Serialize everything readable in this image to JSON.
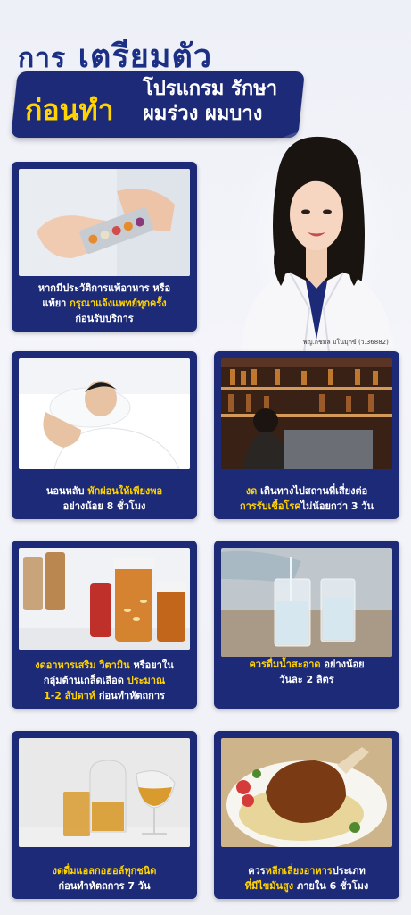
{
  "title": {
    "line1_prefix": "การ",
    "line1_main": "เตรียมตัว",
    "line2_left": "ก่อนทำ",
    "line2_right_top": "โปรแกรม รักษา",
    "line2_right_bottom": "ผมร่วง ผมบาง"
  },
  "doctor": {
    "caption": "พญ.กชมล มโนมุกข์ (ว.36882)"
  },
  "cards": [
    {
      "lines": [
        [
          {
            "t": "หากมีประวัติการแพ้อาหาร หรือ",
            "h": false
          }
        ],
        [
          {
            "t": "แพ้ยา ",
            "h": false
          },
          {
            "t": "กรุณาแจ้งแพทย์ทุกครั้ง",
            "h": true
          }
        ],
        [
          {
            "t": "ก่อนรับบริการ",
            "h": false
          }
        ]
      ]
    },
    {
      "lines": [
        [
          {
            "t": "นอนหลับ ",
            "h": false
          },
          {
            "t": "พักผ่อนให้เพียงพอ",
            "h": true
          }
        ],
        [
          {
            "t": "อย่างน้อย 8 ชั่วโมง",
            "h": false
          }
        ]
      ]
    },
    {
      "lines": [
        [
          {
            "t": "งด ",
            "h": true
          },
          {
            "t": "เดินทางไปสถานที่เสี่ยงต่อ",
            "h": false
          }
        ],
        [
          {
            "t": "การรับเชื้อโรค",
            "h": true
          },
          {
            "t": "ไม่น้อยกว่า 3 วัน",
            "h": false
          }
        ]
      ]
    },
    {
      "lines": [
        [
          {
            "t": "งดอาหารเสริม วิตามิน ",
            "h": true
          },
          {
            "t": "หรือยาใน",
            "h": false
          }
        ],
        [
          {
            "t": "กลุ่มต้านเกล็ดเลือด ",
            "h": false
          },
          {
            "t": "ประมาณ",
            "h": true
          }
        ],
        [
          {
            "t": "1-2 สัปดาห์ ",
            "h": true
          },
          {
            "t": "ก่อนทำหัตถการ",
            "h": false
          }
        ]
      ]
    },
    {
      "lines": [
        [
          {
            "t": "ควรดื่มน้ำสะอาด ",
            "h": true
          },
          {
            "t": "อย่างน้อย",
            "h": false
          }
        ],
        [
          {
            "t": "วันละ 2 ลิตร",
            "h": false
          }
        ]
      ]
    },
    {
      "lines": [
        [
          {
            "t": "งดดื่มแอลกอฮอล์ทุกชนิด",
            "h": true
          }
        ],
        [
          {
            "t": "ก่อนทำหัตถการ 7 วัน",
            "h": false
          }
        ]
      ]
    },
    {
      "lines": [
        [
          {
            "t": "ควร",
            "h": false
          },
          {
            "t": "หลีกเลี่ยงอาหาร",
            "h": true
          },
          {
            "t": "ประเภท",
            "h": false
          }
        ],
        [
          {
            "t": "ที่มีไขมันสูง ",
            "h": true
          },
          {
            "t": "ภายใน 6 ชั่วโมง",
            "h": false
          }
        ]
      ]
    }
  ],
  "colors": {
    "navy": "#1d2a78",
    "yellow": "#ffd400",
    "title_blue": "#1b2f85"
  },
  "illustrations": [
    "pills-in-hand-photo",
    "sleeping-man-photo",
    "bar-shelves-photo",
    "supplement-bottles-photo",
    "water-glasses-photo",
    "alcohol-glasses-photo",
    "fatty-meat-dish-photo",
    "doctor-portrait"
  ]
}
